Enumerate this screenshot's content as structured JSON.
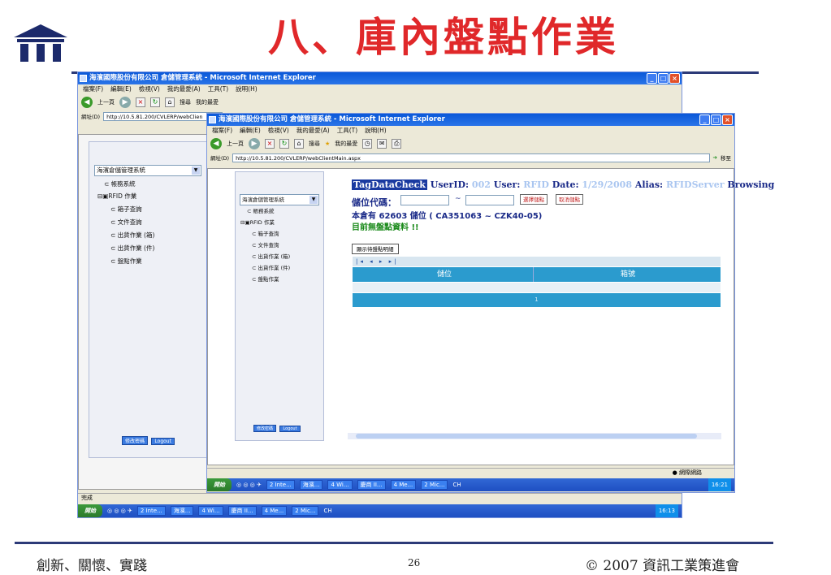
{
  "slide": {
    "title": "八、庫內盤點作業",
    "footer_left": "創新、關懷、實踐",
    "page_number": "26",
    "footer_right": "© 2007 資訊工業策進會"
  },
  "back_window": {
    "title": "海濱國際股份有限公司 倉儲管理系統 - Microsoft Internet Explorer",
    "menu": [
      "檔案(F)",
      "編輯(E)",
      "檢視(V)",
      "我的最愛(A)",
      "工具(T)",
      "說明(H)"
    ],
    "toolbar": {
      "back": "上一頁",
      "search": "搜尋",
      "favorites": "我的最愛"
    },
    "address_label": "網址(D)",
    "address_value": "http://10.5.81.200/CVLERP/webClien",
    "status": "完成",
    "tree": {
      "dropdown": "海濱倉儲管理系統",
      "items": [
        "帳務系統",
        "RFID 作業",
        "箱子查詢",
        "文件查詢",
        "出貨作業 (箱)",
        "出貨作業 (件)",
        "盤點作業"
      ]
    },
    "buttons": [
      "修改密碼",
      "Logout"
    ],
    "taskbar": {
      "start": "開始",
      "items": [
        "2 Inte...",
        "海濱...",
        "4 Wi...",
        "慶商 II...",
        "4 Me...",
        "2 Mic..."
      ],
      "tray_lang": "CH",
      "time": "16:13"
    }
  },
  "front_window": {
    "title": "海濱國際股份有限公司 倉儲管理系統 - Microsoft Internet Explorer",
    "menu": [
      "檔案(F)",
      "編輯(E)",
      "檢視(V)",
      "我的最愛(A)",
      "工具(T)",
      "說明(H)"
    ],
    "toolbar": {
      "back": "上一頁",
      "search": "搜尋",
      "favorites": "我的最愛"
    },
    "address_label": "網址(D)",
    "address_value": "http://10.5.81.200/CVLERP/webClientMain.aspx",
    "go_label": "移至",
    "tree": {
      "dropdown": "海濱倉儲管理系統",
      "items": [
        "帳務系統",
        "RFID 作業",
        "箱子查詢",
        "文件查詢",
        "出貨作業 (箱)",
        "出貨作業 (件)",
        "盤點作業"
      ]
    },
    "buttons": [
      "修改密碼",
      "Logout"
    ],
    "content": {
      "header": {
        "page": "TagDataCheck",
        "userid_label": "UserID:",
        "userid_value": "002",
        "user_label": "User:",
        "user_value": "RFID",
        "date_label": "Date:",
        "date_value": "1/29/2008",
        "alias_label": "Alias:",
        "alias_value": "RFIDServer",
        "mode": "Browsing"
      },
      "location_label": "儲位代碼：",
      "location_from": "",
      "location_sep": "~",
      "location_to": "",
      "select_button": "選擇儲點",
      "cancel_button": "取消儲點",
      "summary": "本倉有 62603 儲位 ( CA351063 ~ CZK40-05)",
      "no_data": "目前無盤點資料 !!",
      "show_detail_button": "顯示待盤點明細",
      "pager": "|◂ ◂ ▸ ▸|",
      "columns": [
        "儲位",
        "箱號"
      ],
      "page_no": "1"
    },
    "status_zone": "網際網路",
    "taskbar": {
      "start": "開始",
      "items": [
        "2 Inte...",
        "海濱...",
        "4 Wi...",
        "慶商 II...",
        "4 Me...",
        "2 Mic..."
      ],
      "tray_lang": "CH",
      "time": "16:21"
    }
  }
}
